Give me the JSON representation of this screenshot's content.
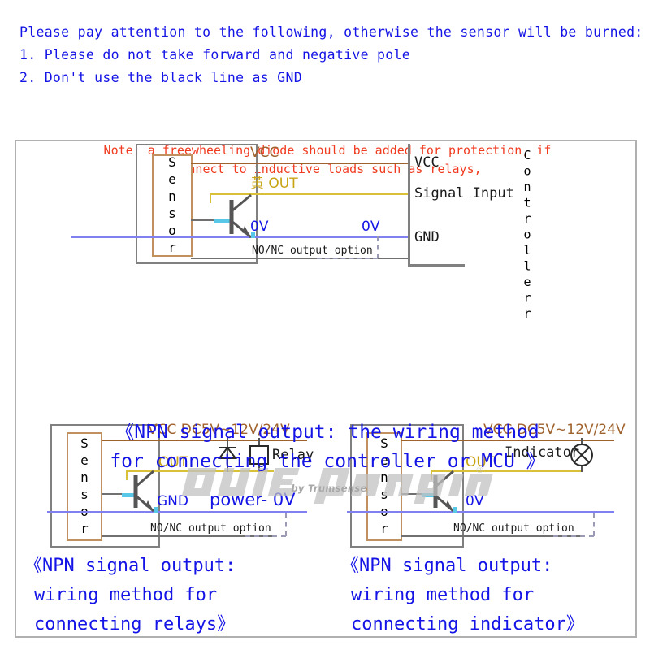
{
  "header": {
    "lines": [
      "Please pay attention to the following, otherwise the sensor will be burned:",
      "1. Please do not take forward and negative pole",
      "2. Don't use the black line as GND"
    ],
    "color": "#1414e6"
  },
  "colors": {
    "vcc_wire": "#a0622c",
    "out_wire": "#d8c038",
    "zero_v_wire": "#8080f0",
    "gray_wire": "#707070",
    "cyan_lead": "#59c7e8",
    "caption_blue": "#1414e6",
    "note_red": "#f03b20",
    "sensor_box_border": "#c09060",
    "frame_border": "#b0b0b0"
  },
  "watermark": {
    "text": "gvit gensopion",
    "registered_mark": "®",
    "subtitle": "by Trumsense"
  },
  "diagram_top": {
    "sensor_label": "Sensor",
    "wires": {
      "vcc": "VCC",
      "out": "黄 OUT",
      "zero_v": "0V",
      "zero_v_dashed": "0V",
      "no_nc_option": "NO/NC output option"
    },
    "controller": {
      "name": "Controllerr",
      "terminals": [
        "VCC",
        "Signal Input",
        "GND"
      ]
    },
    "caption": [
      "《NPN signal output: the wiring method",
      "for connecting the controller or MCU 》"
    ]
  },
  "note": {
    "lines": [
      "Note: a freewheeling diode should be added for protection, if",
      "connect to inductive loads such as relays,"
    ]
  },
  "diagram_relay": {
    "sensor_label": "Sensor",
    "wires": {
      "vcc": "VCC DC5V~12V/24V",
      "out": "OUT",
      "gnd": "GND",
      "power_0v": "power- 0V",
      "no_nc_option": "NO/NC output option"
    },
    "components": {
      "diode": "freewheeling-diode",
      "relay": "Relay"
    },
    "caption": [
      "《NPN signal output:",
      "wiring method for",
      "connecting relays》"
    ]
  },
  "diagram_indicator": {
    "sensor_label": "Sensor",
    "wires": {
      "vcc": "VCC DC5V~12V/24V",
      "out": "OUT",
      "zero_v": "0V",
      "no_nc_option": "NO/NC output option"
    },
    "components": {
      "indicator": "Indicator"
    },
    "caption": [
      "《NPN signal output:",
      "wiring method for",
      "connecting indicator》"
    ]
  }
}
